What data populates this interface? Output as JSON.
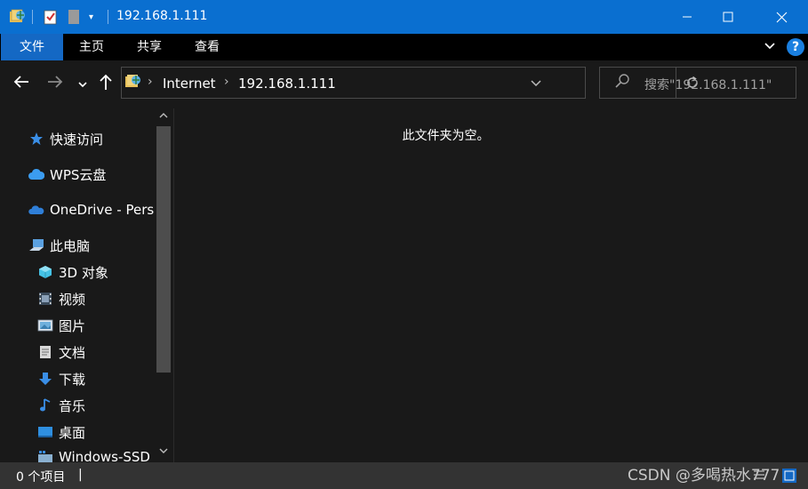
{
  "window": {
    "title": "192.168.1.111",
    "controls": [
      "minimize",
      "maximize",
      "close"
    ]
  },
  "ribbon": {
    "tabs": [
      {
        "label": "文件",
        "active": true
      },
      {
        "label": "主页",
        "active": false
      },
      {
        "label": "共享",
        "active": false
      },
      {
        "label": "查看",
        "active": false
      }
    ],
    "help_label": "?"
  },
  "address": {
    "segments": [
      "Internet",
      "192.168.1.111"
    ]
  },
  "search": {
    "placeholder": "搜索\"192.168.1.111\""
  },
  "sidebar": {
    "items": [
      {
        "label": "快速访问",
        "icon": "star-icon",
        "color": "#3a8ee6"
      },
      {
        "label": "WPS云盘",
        "icon": "cloud-icon",
        "color": "#3b9cf0"
      },
      {
        "label": "OneDrive - Perso",
        "icon": "onedrive-icon",
        "color": "#2f7fd8"
      },
      {
        "label": "此电脑",
        "icon": "computer-icon",
        "color": "#5aa0e0"
      },
      {
        "label": "3D 对象",
        "icon": "cube-icon",
        "color": "#45c2e6"
      },
      {
        "label": "视频",
        "icon": "film-icon",
        "color": "#8aa0b8"
      },
      {
        "label": "图片",
        "icon": "picture-icon",
        "color": "#6fb0dc"
      },
      {
        "label": "文档",
        "icon": "document-icon",
        "color": "#d8d8d8"
      },
      {
        "label": "下载",
        "icon": "download-arrow-icon",
        "color": "#3a8ee6"
      },
      {
        "label": "音乐",
        "icon": "music-note-icon",
        "color": "#3a8ee6"
      },
      {
        "label": "桌面",
        "icon": "desktop-icon",
        "color": "#2f8fe0"
      },
      {
        "label": "Windows-SSD",
        "icon": "drive-icon",
        "color": "#8ab0d0"
      }
    ]
  },
  "content": {
    "empty_message": "此文件夹为空。"
  },
  "status": {
    "item_count": "0 个项目",
    "separator": "|"
  },
  "watermark": "CSDN @多喝热水777"
}
